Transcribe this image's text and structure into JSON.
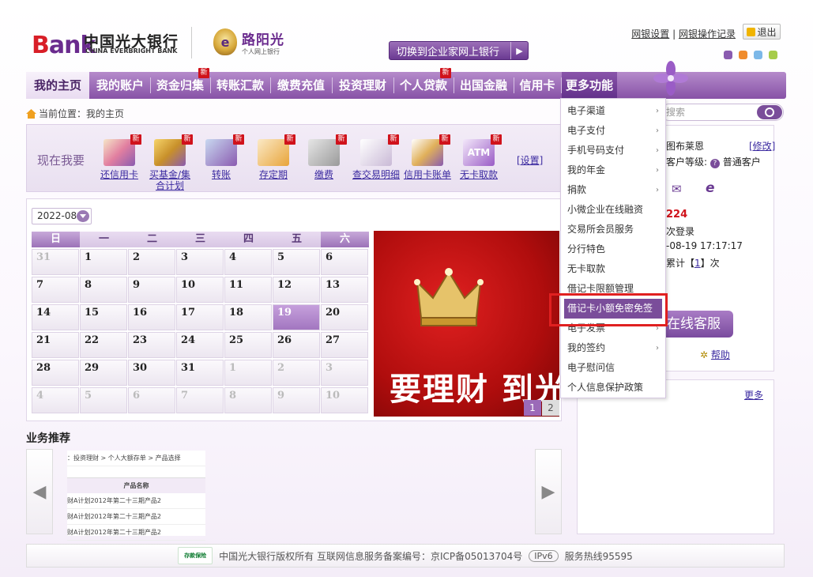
{
  "header": {
    "logo_bank_b": "B",
    "logo_bank_rest": "ank",
    "logo_cn": "中国光大银行",
    "logo_en": "CHINA EVERBRIGHT BANK",
    "lyg_title": "路阳光",
    "lyg_sub": "个人网上银行",
    "switch_label": "切换到企业家网上银行",
    "link_settings": "网银设置",
    "link_log": "网银操作记录",
    "logout": "退出",
    "theme_colors": [
      "#8a5bb0",
      "#f08c2c",
      "#7cb8e8",
      "#a6cc4a"
    ]
  },
  "nav": {
    "items": [
      {
        "label": "我的主页"
      },
      {
        "label": "我的账户"
      },
      {
        "label": "资金归集"
      },
      {
        "label": "转账汇款"
      },
      {
        "label": "缴费充值"
      },
      {
        "label": "投资理财"
      },
      {
        "label": "个人贷款"
      },
      {
        "label": "出国金融"
      },
      {
        "label": "信用卡"
      },
      {
        "label": "更多功能"
      }
    ],
    "new_tag": "新"
  },
  "breadcrumb": "当前位置：我的主页",
  "quick": {
    "label": "现在我要",
    "items": [
      {
        "line1": "还信用卡",
        "line2": ""
      },
      {
        "line1": "买基金/集",
        "line2": "合计划"
      },
      {
        "line1": "转账",
        "line2": ""
      },
      {
        "line1": "存定期",
        "line2": ""
      },
      {
        "line1": "缴费",
        "line2": ""
      },
      {
        "line1": "查交易明细",
        "line2": ""
      },
      {
        "line1": "信用卡账单",
        "line2": ""
      },
      {
        "line1": "无卡取款",
        "line2": ""
      }
    ],
    "settings": "[设置]"
  },
  "calendar": {
    "month": "2022-08",
    "weekdays": [
      "日",
      "一",
      "二",
      "三",
      "四",
      "五",
      "六"
    ],
    "weeks": [
      [
        "31",
        "1",
        "2",
        "3",
        "4",
        "5",
        "6"
      ],
      [
        "7",
        "8",
        "9",
        "10",
        "11",
        "12",
        "13"
      ],
      [
        "14",
        "15",
        "16",
        "17",
        "18",
        "19",
        "20"
      ],
      [
        "21",
        "22",
        "23",
        "24",
        "25",
        "26",
        "27"
      ],
      [
        "28",
        "29",
        "30",
        "31",
        "1",
        "2",
        "3"
      ],
      [
        "4",
        "5",
        "6",
        "7",
        "8",
        "9",
        "10"
      ]
    ],
    "today": "19"
  },
  "banner": {
    "text": "要理财 到光大",
    "pages": [
      "1",
      "2"
    ]
  },
  "recommend": {
    "title": "业务推荐",
    "crumb": "：投资理财 > 个人大额存单 > 产品选择",
    "col": "产品名称",
    "rows": [
      "财A计划2012年第二十三期产品2",
      "财A计划2012年第二十三期产品2",
      "财A计划2012年第二十三期产品2"
    ],
    "left": "◀",
    "right": "▶"
  },
  "right": {
    "search_placeholder": "搜索",
    "name": "图布莱恩",
    "edit": "[修改]",
    "level_label": "客户等级:",
    "level": "普通客户",
    "code": "224",
    "login_count": "次登录",
    "last_login": "-08-19 17:17:17",
    "total_prefix": "累计【",
    "total_count": "1",
    "total_suffix": "】次",
    "service": "在线客服",
    "help": "帮助",
    "more": "更多"
  },
  "menu": {
    "items": [
      {
        "label": "电子渠道",
        "sub": true
      },
      {
        "label": "电子支付",
        "sub": true
      },
      {
        "label": "手机号码支付",
        "sub": true
      },
      {
        "label": "我的年金",
        "sub": true
      },
      {
        "label": "捐款",
        "sub": true
      },
      {
        "label": "小微企业在线融资",
        "sub": false
      },
      {
        "label": "交易所会员服务",
        "sub": false
      },
      {
        "label": "分行特色",
        "sub": false
      },
      {
        "label": "无卡取款",
        "sub": false
      },
      {
        "label": "借记卡限额管理",
        "sub": false
      },
      {
        "label": "借记卡小额免密免签",
        "sub": false
      },
      {
        "label": "电子发票",
        "sub": true
      },
      {
        "label": "我的签约",
        "sub": true
      },
      {
        "label": "电子慰问信",
        "sub": false
      },
      {
        "label": "个人信息保护政策",
        "sub": false
      }
    ],
    "chevron": "›"
  },
  "footer": {
    "deposit": "存款保险",
    "text": "中国光大银行版权所有 互联网信息服务备案编号：京ICP备05013704号",
    "ipv6": "IPv6",
    "hotline": "服务热线95595"
  }
}
